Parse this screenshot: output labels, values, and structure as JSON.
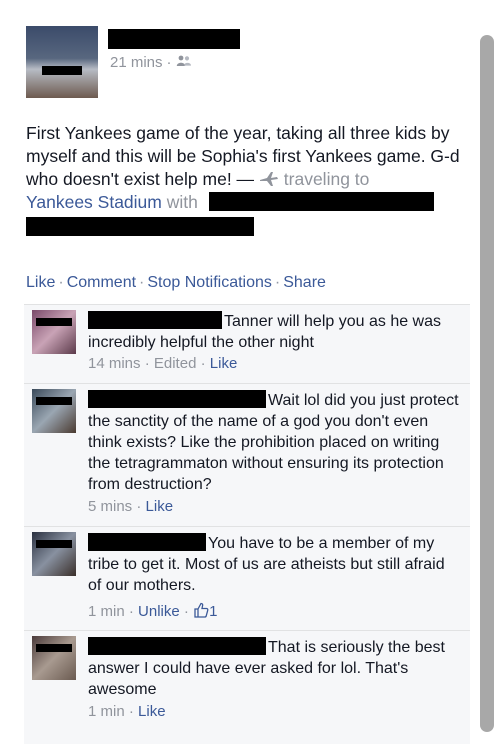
{
  "close_label": "×",
  "post": {
    "time": "21 mins",
    "separator": "·",
    "text_main": "First Yankees game of the year, taking all three kids by myself and this will be Sophia's first Yankees game. G-d who doesn't exist help me! — ",
    "activity": "traveling to",
    "place": "Yankees Stadium",
    "with_label": "with"
  },
  "actions": {
    "like": "Like",
    "comment": "Comment",
    "stop_notifications": "Stop Notifications",
    "share": "Share",
    "sep": "·"
  },
  "comments": [
    {
      "text": "Tanner will help you as he was incredibly helpful the other night",
      "time": "14 mins",
      "edited": "Edited",
      "like": "Like"
    },
    {
      "text": "Wait lol did you just protect the sanctity of the name of a god you don't even think exists? Like the prohibition placed on writing the tetragrammaton without ensuring its protection from destruction?",
      "time": "5 mins",
      "like": "Like"
    },
    {
      "text": "You have to be a member of my tribe to get it. Most of us are atheists but still afraid of our mothers.",
      "time": "1 min",
      "like": "Unlike",
      "like_count": "1"
    },
    {
      "text": "That is seriously the best answer I could have ever asked for lol. That's awesome",
      "time": "1 min",
      "like": "Like"
    }
  ],
  "icons": {
    "privacy": "friends-icon",
    "activity": "airplane-icon",
    "like_count": "thumbs-up-icon",
    "close": "close-icon"
  }
}
